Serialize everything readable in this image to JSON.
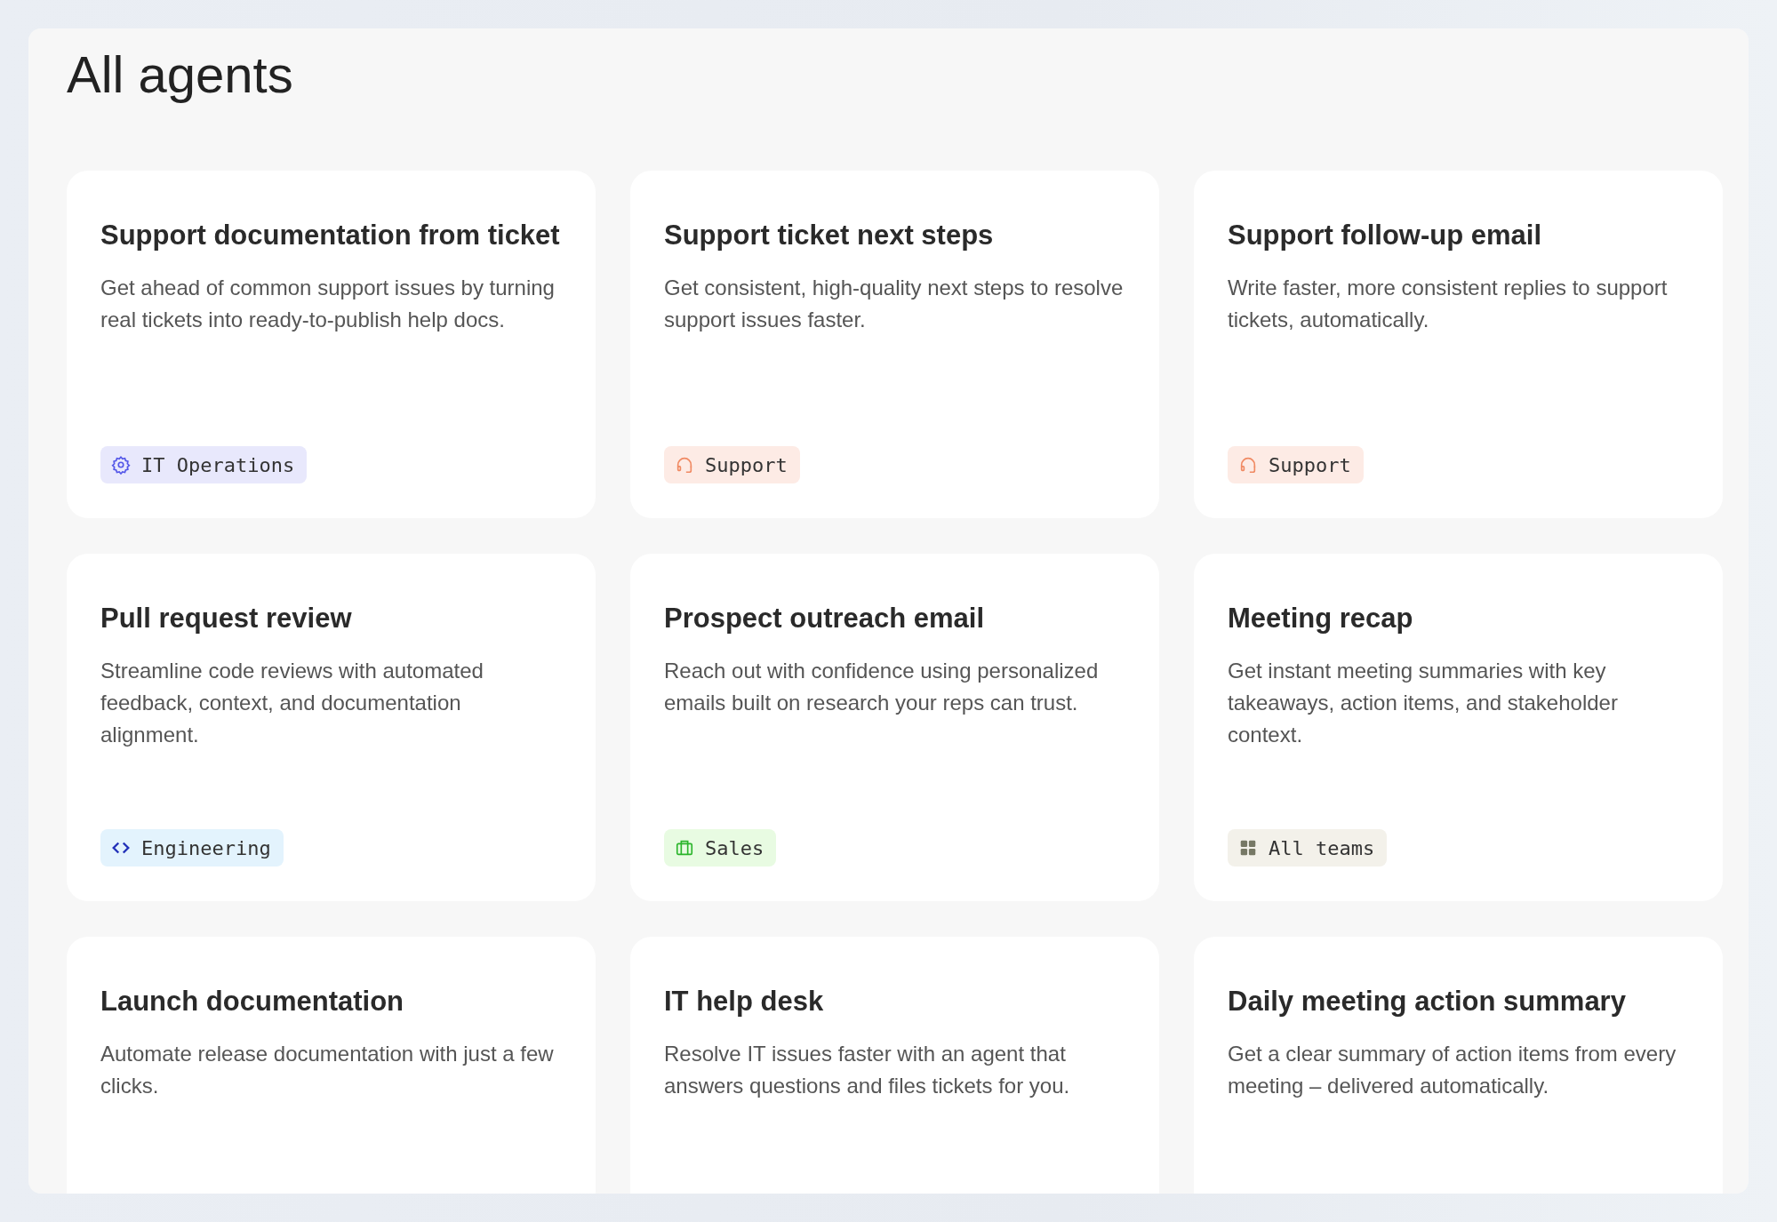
{
  "page": {
    "title": "All agents"
  },
  "agents": [
    {
      "title": "Support documentation from ticket",
      "description": "Get ahead of common support issues by turning real tickets into ready-to-publish help docs.",
      "tag": {
        "kind": "it",
        "label": "IT Operations"
      }
    },
    {
      "title": "Support ticket next steps",
      "description": "Get consistent, high-quality next steps to resolve support issues faster.",
      "tag": {
        "kind": "support",
        "label": "Support"
      }
    },
    {
      "title": "Support follow-up email",
      "description": "Write faster, more consistent replies to support tickets, automatically.",
      "tag": {
        "kind": "support",
        "label": "Support"
      }
    },
    {
      "title": "Pull request review",
      "description": "Streamline code reviews with automated feedback, context, and documentation alignment.",
      "tag": {
        "kind": "engineering",
        "label": "Engineering"
      }
    },
    {
      "title": "Prospect outreach email",
      "description": "Reach out with confidence using personalized emails built on research your reps can trust.",
      "tag": {
        "kind": "sales",
        "label": "Sales"
      }
    },
    {
      "title": "Meeting recap",
      "description": "Get instant meeting summaries with key takeaways, action items, and stakeholder context.",
      "tag": {
        "kind": "all",
        "label": "All teams"
      }
    },
    {
      "title": "Launch documentation",
      "description": "Automate release documentation with just a few clicks."
    },
    {
      "title": "IT help desk",
      "description": "Resolve IT issues faster with an agent that answers questions and files tickets for you."
    },
    {
      "title": "Daily meeting action summary",
      "description": "Get a clear summary of action items from every meeting – delivered automatically."
    }
  ]
}
